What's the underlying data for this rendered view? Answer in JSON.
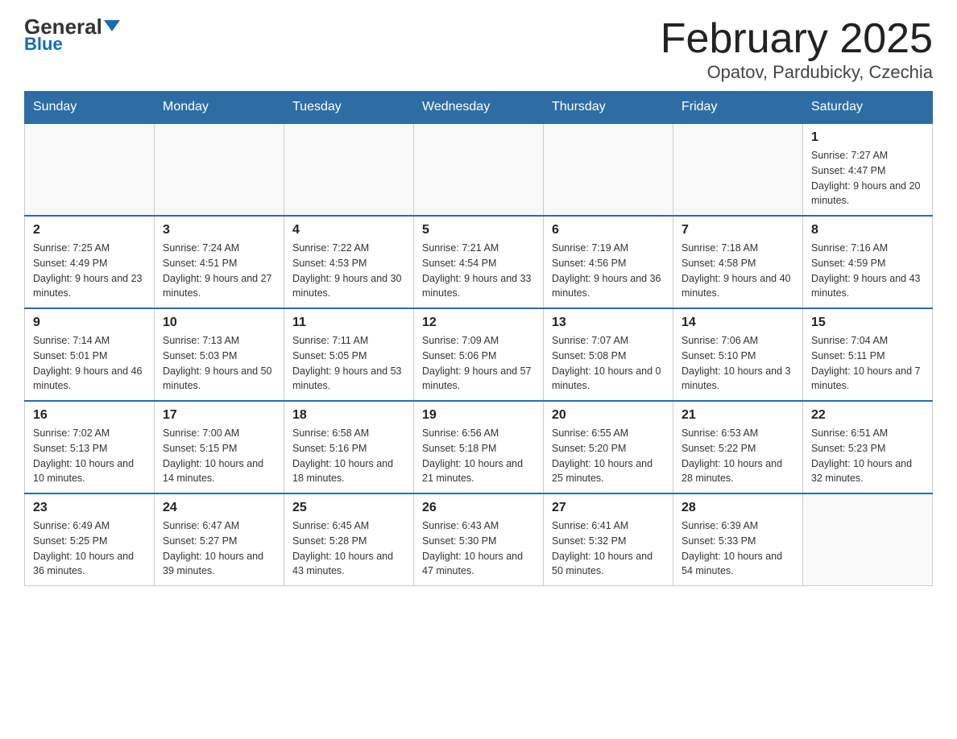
{
  "header": {
    "logo_general": "General",
    "logo_blue": "Blue",
    "title": "February 2025",
    "subtitle": "Opatov, Pardubicky, Czechia"
  },
  "days_of_week": [
    "Sunday",
    "Monday",
    "Tuesday",
    "Wednesday",
    "Thursday",
    "Friday",
    "Saturday"
  ],
  "weeks": [
    [
      {
        "day": "",
        "info": ""
      },
      {
        "day": "",
        "info": ""
      },
      {
        "day": "",
        "info": ""
      },
      {
        "day": "",
        "info": ""
      },
      {
        "day": "",
        "info": ""
      },
      {
        "day": "",
        "info": ""
      },
      {
        "day": "1",
        "info": "Sunrise: 7:27 AM\nSunset: 4:47 PM\nDaylight: 9 hours and 20 minutes."
      }
    ],
    [
      {
        "day": "2",
        "info": "Sunrise: 7:25 AM\nSunset: 4:49 PM\nDaylight: 9 hours and 23 minutes."
      },
      {
        "day": "3",
        "info": "Sunrise: 7:24 AM\nSunset: 4:51 PM\nDaylight: 9 hours and 27 minutes."
      },
      {
        "day": "4",
        "info": "Sunrise: 7:22 AM\nSunset: 4:53 PM\nDaylight: 9 hours and 30 minutes."
      },
      {
        "day": "5",
        "info": "Sunrise: 7:21 AM\nSunset: 4:54 PM\nDaylight: 9 hours and 33 minutes."
      },
      {
        "day": "6",
        "info": "Sunrise: 7:19 AM\nSunset: 4:56 PM\nDaylight: 9 hours and 36 minutes."
      },
      {
        "day": "7",
        "info": "Sunrise: 7:18 AM\nSunset: 4:58 PM\nDaylight: 9 hours and 40 minutes."
      },
      {
        "day": "8",
        "info": "Sunrise: 7:16 AM\nSunset: 4:59 PM\nDaylight: 9 hours and 43 minutes."
      }
    ],
    [
      {
        "day": "9",
        "info": "Sunrise: 7:14 AM\nSunset: 5:01 PM\nDaylight: 9 hours and 46 minutes."
      },
      {
        "day": "10",
        "info": "Sunrise: 7:13 AM\nSunset: 5:03 PM\nDaylight: 9 hours and 50 minutes."
      },
      {
        "day": "11",
        "info": "Sunrise: 7:11 AM\nSunset: 5:05 PM\nDaylight: 9 hours and 53 minutes."
      },
      {
        "day": "12",
        "info": "Sunrise: 7:09 AM\nSunset: 5:06 PM\nDaylight: 9 hours and 57 minutes."
      },
      {
        "day": "13",
        "info": "Sunrise: 7:07 AM\nSunset: 5:08 PM\nDaylight: 10 hours and 0 minutes."
      },
      {
        "day": "14",
        "info": "Sunrise: 7:06 AM\nSunset: 5:10 PM\nDaylight: 10 hours and 3 minutes."
      },
      {
        "day": "15",
        "info": "Sunrise: 7:04 AM\nSunset: 5:11 PM\nDaylight: 10 hours and 7 minutes."
      }
    ],
    [
      {
        "day": "16",
        "info": "Sunrise: 7:02 AM\nSunset: 5:13 PM\nDaylight: 10 hours and 10 minutes."
      },
      {
        "day": "17",
        "info": "Sunrise: 7:00 AM\nSunset: 5:15 PM\nDaylight: 10 hours and 14 minutes."
      },
      {
        "day": "18",
        "info": "Sunrise: 6:58 AM\nSunset: 5:16 PM\nDaylight: 10 hours and 18 minutes."
      },
      {
        "day": "19",
        "info": "Sunrise: 6:56 AM\nSunset: 5:18 PM\nDaylight: 10 hours and 21 minutes."
      },
      {
        "day": "20",
        "info": "Sunrise: 6:55 AM\nSunset: 5:20 PM\nDaylight: 10 hours and 25 minutes."
      },
      {
        "day": "21",
        "info": "Sunrise: 6:53 AM\nSunset: 5:22 PM\nDaylight: 10 hours and 28 minutes."
      },
      {
        "day": "22",
        "info": "Sunrise: 6:51 AM\nSunset: 5:23 PM\nDaylight: 10 hours and 32 minutes."
      }
    ],
    [
      {
        "day": "23",
        "info": "Sunrise: 6:49 AM\nSunset: 5:25 PM\nDaylight: 10 hours and 36 minutes."
      },
      {
        "day": "24",
        "info": "Sunrise: 6:47 AM\nSunset: 5:27 PM\nDaylight: 10 hours and 39 minutes."
      },
      {
        "day": "25",
        "info": "Sunrise: 6:45 AM\nSunset: 5:28 PM\nDaylight: 10 hours and 43 minutes."
      },
      {
        "day": "26",
        "info": "Sunrise: 6:43 AM\nSunset: 5:30 PM\nDaylight: 10 hours and 47 minutes."
      },
      {
        "day": "27",
        "info": "Sunrise: 6:41 AM\nSunset: 5:32 PM\nDaylight: 10 hours and 50 minutes."
      },
      {
        "day": "28",
        "info": "Sunrise: 6:39 AM\nSunset: 5:33 PM\nDaylight: 10 hours and 54 minutes."
      },
      {
        "day": "",
        "info": ""
      }
    ]
  ],
  "accent_color": "#2e6da4"
}
